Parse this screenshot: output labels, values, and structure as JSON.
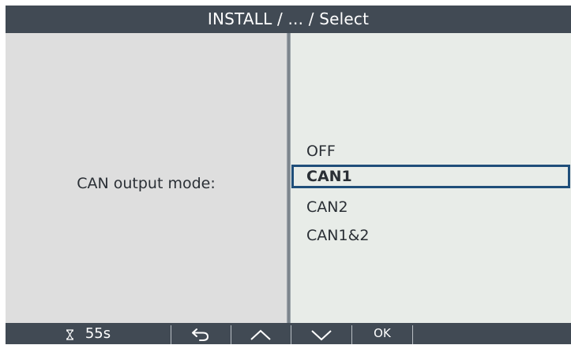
{
  "title": "INSTALL / ... / Select",
  "parameter": {
    "label": "CAN output mode:"
  },
  "options": [
    {
      "label": "OFF",
      "selected": false
    },
    {
      "label": "CAN1",
      "selected": true
    },
    {
      "label": "CAN2",
      "selected": false
    },
    {
      "label": "CAN1&2",
      "selected": false
    }
  ],
  "footer": {
    "timer_icon": "hourglass-icon",
    "timer": "55s",
    "back_icon": "back-arrow-icon",
    "up_icon": "chevron-up-icon",
    "down_icon": "chevron-down-icon",
    "ok_label": "OK"
  },
  "colors": {
    "title_bar": "#414a54",
    "selection_border": "#1f4e7a",
    "left_panel": "#dedede",
    "right_panel": "#e8ece8"
  }
}
